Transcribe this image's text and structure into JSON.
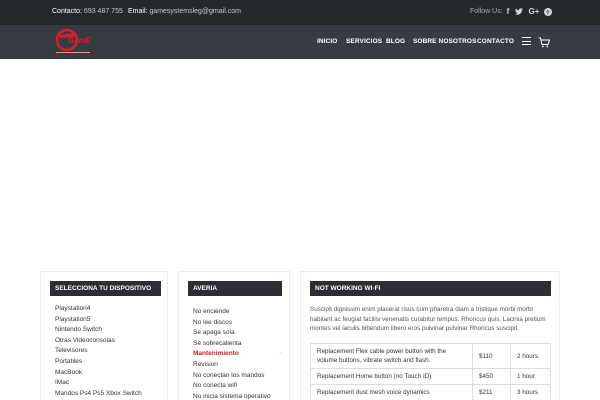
{
  "topbar": {
    "contact_label": "Contacto:",
    "contact_phone": "693 487 755",
    "email_label": "Email:",
    "email_value": "gamesystemsleg@gmail.com",
    "follow_label": "Follow Us:",
    "social_icons": [
      "facebook-icon",
      "twitter-icon",
      "google-plus-icon",
      "pinterest-icon"
    ]
  },
  "header": {
    "logo_icon": "game-systems-logo",
    "nav": [
      "INICIO",
      "SERVICIOS",
      "BLOG",
      "SOBRE NOSOTROS",
      "CONTACTO"
    ],
    "menu_icon": "hamburger-icon",
    "cart_icon": "cart-icon"
  },
  "devices": {
    "title": "SELECCIONA TU DISPOSITIVO",
    "items": [
      "Playstation4",
      "Playstation5",
      "Nintendo Switch",
      "Otras Videoconsolas",
      "Televisores",
      "Portatiles",
      "MacBook",
      "IMac",
      "Mandos Ps4 Ps5 Xbox Switch"
    ]
  },
  "faults": {
    "title": "AVERIA",
    "items": [
      "No enciende",
      "No lee discos",
      "Se apaga sola",
      "Se sobrecalienta",
      "Mantenimiento",
      "Revision",
      "No conectan los mandos",
      "No conecta wifi",
      "No inicia sistema operativo"
    ],
    "active_item": "Mantenimiento"
  },
  "detail": {
    "title": "NOT WORKING WI-FI",
    "description": "Suscipit dignissim enim placerat risus cum pharetra diam a tristique morbi morbi habitant ac feugiat facilisi venenatis curabitur tempus. Rhoncus quis. Lacinia pretium montes vel iaculis bibendum libero eros pulvinar pulvinar Rhoncus suscipit.",
    "prices": [
      {
        "service": "Replacement Flex cable power button with the volume buttons, vibrate switch and flash.",
        "price": "$110",
        "time": "2 hours"
      },
      {
        "service": "Replacement Home button (no Touch ID)",
        "price": "$450",
        "time": "1 hour"
      },
      {
        "service": "Replacement dust mesh voice dynamics",
        "price": "$211",
        "time": "3 hours"
      }
    ]
  },
  "colors": {
    "topbar_bg": "#25282d",
    "header_bg": "#373c44",
    "title_bar_bg": "#2b2f35",
    "active_red": "#c0262d"
  }
}
